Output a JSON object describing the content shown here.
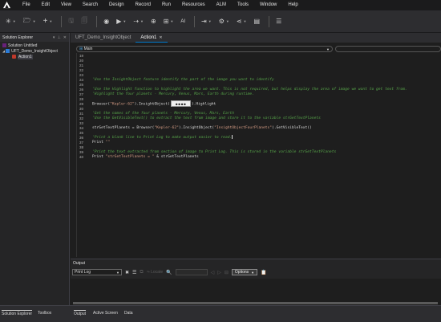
{
  "menu": [
    "File",
    "Edit",
    "View",
    "Search",
    "Design",
    "Record",
    "Run",
    "Resources",
    "ALM",
    "Tools",
    "Window",
    "Help"
  ],
  "toolbar": {
    "ai_label": "AI"
  },
  "explorer": {
    "title": "Solution Explorer",
    "tree": [
      {
        "label": "Solution Untitled",
        "icon": "solution-icon"
      },
      {
        "label": "UFT_Demo_InsightObject",
        "icon": "test-icon"
      },
      {
        "label": "Action1",
        "icon": "action-icon"
      }
    ]
  },
  "editor": {
    "tabs": [
      {
        "label": "UFT_Demo_InsightObject"
      },
      {
        "label": "Action1"
      }
    ],
    "scope": "Main",
    "lines": [
      {
        "n": "19",
        "parts": []
      },
      {
        "n": "20",
        "parts": []
      },
      {
        "n": "21",
        "parts": []
      },
      {
        "n": "22",
        "parts": []
      },
      {
        "n": "23",
        "parts": []
      },
      {
        "n": "24",
        "parts": [
          {
            "t": "'Use the InsightObject feature identify the part of the image you want to identify",
            "c": "c-comment"
          }
        ]
      },
      {
        "n": "25",
        "parts": []
      },
      {
        "n": "26",
        "parts": [
          {
            "t": "'Use the Highlight function to highlight the area we want. This is not required, but helps display the area of image we want to get text from.",
            "c": "c-comment"
          }
        ]
      },
      {
        "n": "27",
        "parts": [
          {
            "t": "'Highlight the four planets - Mercury, Venus, Mars, Earth during runtime.",
            "c": "c-comment"
          }
        ]
      },
      {
        "n": "28",
        "parts": []
      },
      {
        "n": "29",
        "parts": [
          {
            "t": "Browser(",
            "c": "c-plain"
          },
          {
            "t": "\"Kepler-62\"",
            "c": "c-string"
          },
          {
            "t": ").InsightObject(",
            "c": "c-plain"
          },
          {
            "insight": true
          },
          {
            "t": ").Highlight",
            "c": "c-plain"
          }
        ]
      },
      {
        "n": "30",
        "parts": []
      },
      {
        "n": "31",
        "parts": [
          {
            "t": "'Get the names of the four planets - Mercury, Venus, Mars, Earth",
            "c": "c-comment"
          }
        ]
      },
      {
        "n": "32",
        "parts": [
          {
            "t": "'Use the GetVisibleText() to extract the text from image and store it to the variable strGetTextPlanets",
            "c": "c-comment"
          }
        ]
      },
      {
        "n": "33",
        "parts": []
      },
      {
        "n": "34",
        "parts": [
          {
            "t": "strGetTextPlanets = Browser(",
            "c": "c-plain"
          },
          {
            "t": "\"Kepler-62\"",
            "c": "c-string"
          },
          {
            "t": ").InsightObject(",
            "c": "c-plain"
          },
          {
            "t": "\"InsightObjectFourPlanets\"",
            "c": "c-string"
          },
          {
            "t": ").GetVisibleText()",
            "c": "c-plain"
          }
        ]
      },
      {
        "n": "35",
        "parts": []
      },
      {
        "n": "36",
        "parts": [
          {
            "t": "'Print a blank line to Print Log to make output easier to read.",
            "c": "c-comment"
          },
          {
            "cursor": true
          }
        ]
      },
      {
        "n": "37",
        "parts": [
          {
            "t": "Print ",
            "c": "c-plain"
          },
          {
            "t": "\"\"",
            "c": "c-string"
          }
        ]
      },
      {
        "n": "38",
        "parts": []
      },
      {
        "n": "39",
        "parts": [
          {
            "t": "'Print the text extracted from section of image to Print Log. This is stored in the variable strGetTextPlanets",
            "c": "c-comment"
          }
        ]
      },
      {
        "n": "40",
        "parts": [
          {
            "t": "Print ",
            "c": "c-plain"
          },
          {
            "t": "\"strGetTextPlanets = \"",
            "c": "c-string"
          },
          {
            "t": " & strGetTextPlanets",
            "c": "c-plain"
          }
        ]
      }
    ]
  },
  "output": {
    "title": "Output",
    "selected_log": "Print Log",
    "locate_label": "Locate",
    "options_label": "Options"
  },
  "bottom_tabs": {
    "left": [
      "Solution Explorer",
      "Toolbox"
    ],
    "right": [
      "Output",
      "Active Screen",
      "Data"
    ]
  },
  "colors": {
    "accent": "#007acc",
    "comment": "#57a64a",
    "string": "#d69d85",
    "background": "#1e1e1e"
  }
}
